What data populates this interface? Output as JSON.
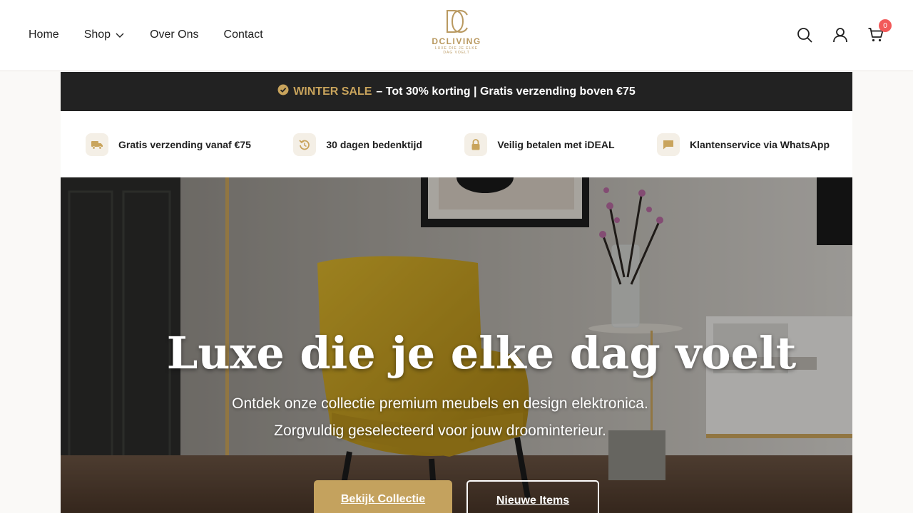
{
  "header": {
    "nav": [
      {
        "label": "Home"
      },
      {
        "label": "Shop"
      },
      {
        "label": "Over Ons"
      },
      {
        "label": "Contact"
      }
    ],
    "logo": {
      "name": "DCLIVING",
      "tagline": "LUXE DIE JE ELKE DAG VOELT"
    },
    "cart_count": "0",
    "icons": [
      "search-icon",
      "account-icon",
      "cart-icon"
    ]
  },
  "sale_banner": {
    "highlight": "WINTER SALE",
    "text": "– Tot 30% korting | Gratis verzending boven €75"
  },
  "features": [
    {
      "icon": "truck-icon",
      "label": "Gratis verzending vanaf €75"
    },
    {
      "icon": "return-icon",
      "label": "30 dagen bedenktijd"
    },
    {
      "icon": "lock-icon",
      "label": "Veilig betalen met iDEAL"
    },
    {
      "icon": "chat-icon",
      "label": "Klantenservice via WhatsApp"
    }
  ],
  "hero": {
    "title": "Luxe die je elke dag voelt",
    "subtitle_line1": "Ontdek onze collectie premium meubels en design elektronica.",
    "subtitle_line2": "Zorgvuldig geselecteerd voor jouw droominterieur.",
    "primary_button": "Bekijk Collectie",
    "secondary_button": "Nieuwe Items"
  },
  "colors": {
    "accent": "#c4a25e",
    "banner_bg": "#222222",
    "badge": "#f25a5a"
  }
}
